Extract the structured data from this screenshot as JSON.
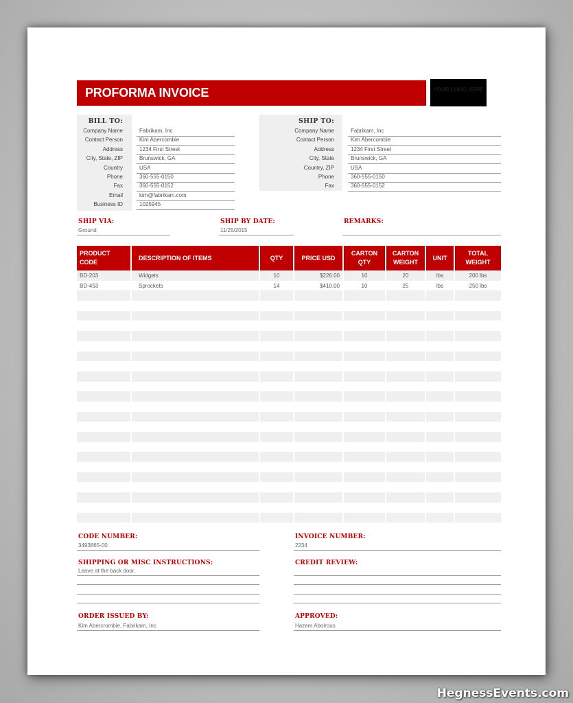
{
  "header": {
    "title": "PROFORMA INVOICE",
    "logo_placeholder": "YOUR LOGO HERE",
    "accent_color": "#c00000"
  },
  "bill_to": {
    "heading": "BILL TO:",
    "rows": [
      {
        "label": "Company Name",
        "value": "Fabrikam, Inc"
      },
      {
        "label": "Contact Person",
        "value": "Kim Abercombie"
      },
      {
        "label": "Address",
        "value": "1234 First Street"
      },
      {
        "label": "City, State, ZIP",
        "value": "Brunswick, GA"
      },
      {
        "label": "Country",
        "value": "USA"
      },
      {
        "label": "Phone",
        "value": "360-555-0150"
      },
      {
        "label": "Fax",
        "value": "360-555-0152"
      },
      {
        "label": "Email",
        "value": "kim@fabrikam.com"
      },
      {
        "label": "Business ID",
        "value": "1025945"
      }
    ]
  },
  "ship_to": {
    "heading": "SHIP TO:",
    "rows": [
      {
        "label": "Company Name",
        "value": "Fabrikam, Inc"
      },
      {
        "label": "Contact Person",
        "value": "Kim Abercombie"
      },
      {
        "label": "Address",
        "value": "1234 First Street"
      },
      {
        "label": "City, State",
        "value": "Brunswick, GA"
      },
      {
        "label": "Country, ZIP",
        "value": "USA"
      },
      {
        "label": "Phone",
        "value": "360-555-0150"
      },
      {
        "label": "Fax",
        "value": "360-555-0152"
      }
    ]
  },
  "shipping": {
    "ship_via_label": "SHIP VIA:",
    "ship_via_value": "Ground",
    "ship_by_date_label": "SHIP BY DATE:",
    "ship_by_date_value": "11/25/2015",
    "remarks_label": "REMARKS:",
    "remarks_value": ""
  },
  "items_table": {
    "columns": [
      "PRODUCT CODE",
      "DESCRIPTION OF ITEMS",
      "QTY",
      "PRICE USD",
      "CARTON QTY",
      "CARTON WEIGHT",
      "UNIT",
      "TOTAL WEIGHT"
    ],
    "rows": [
      [
        "BD-203",
        "Widgets",
        "10",
        "$226.00",
        "10",
        "20",
        "lbs",
        "200 lbs"
      ],
      [
        "BD-453",
        "Sprockets",
        "14",
        "$410.00",
        "10",
        "25",
        "lbs",
        "250 lbs"
      ]
    ],
    "empty_row_count": 24
  },
  "footer": {
    "code_number_label": "CODE NUMBER:",
    "code_number_value": "3493865-00",
    "invoice_number_label": "INVOICE NUMBER:",
    "invoice_number_value": "2234",
    "instructions_label": "SHIPPING OR MISC INSTRUCTIONS:",
    "instructions_value": "Leave at the back door.",
    "credit_review_label": "CREDIT REVIEW:",
    "credit_review_value": "",
    "order_issued_by_label": "ORDER ISSUED BY:",
    "order_issued_by_value": "Kim Abercrombie, Fabrikam, Inc",
    "approved_label": "APPROVED:",
    "approved_value": "Hazem Abolrous"
  },
  "watermark": "HegnessEvents.com"
}
